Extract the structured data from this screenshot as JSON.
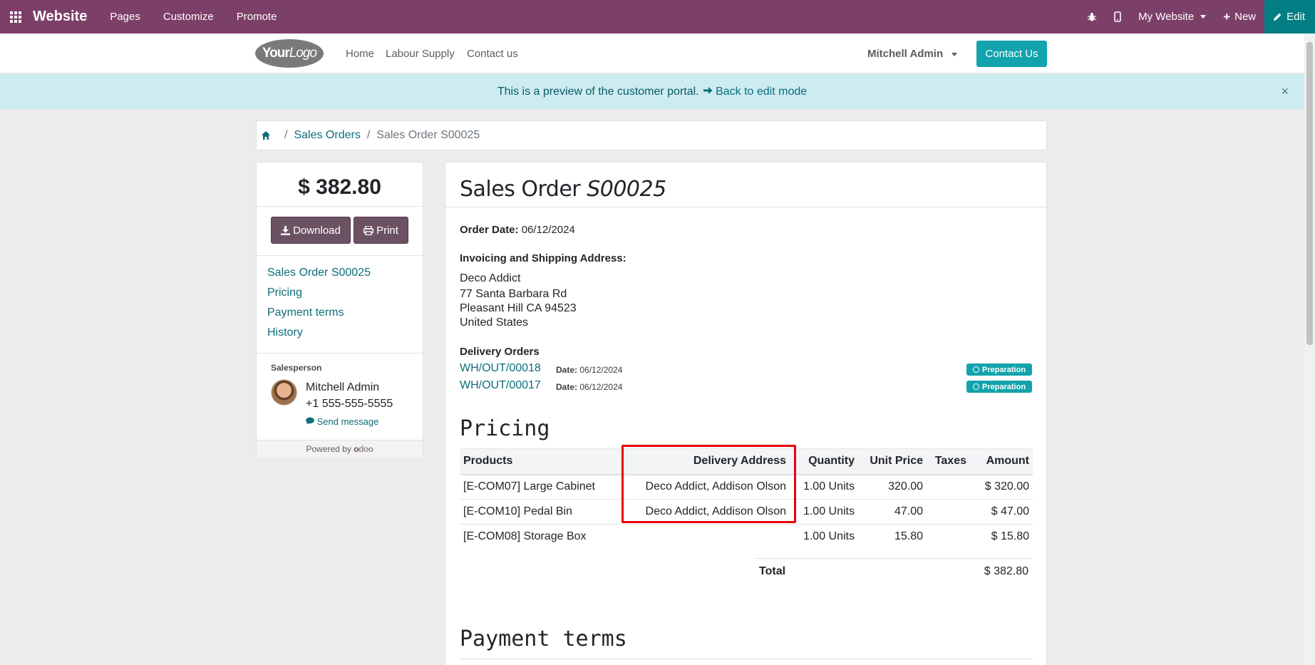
{
  "topbar": {
    "brand": "Website",
    "menus": [
      "Pages",
      "Customize",
      "Promote"
    ],
    "site_selector": "My Website",
    "new_label": "New",
    "edit_label": "Edit",
    "color": "#7c3f68"
  },
  "header": {
    "logo_text_bold": "Your",
    "logo_text": "Logo",
    "nav": [
      "Home",
      "Labour Supply",
      "Contact us"
    ],
    "user": "Mitchell Admin",
    "contact_button": "Contact Us"
  },
  "banner": {
    "text": "This is a preview of the customer portal.",
    "back_link": "Back to edit mode",
    "close": "×"
  },
  "breadcrumb": {
    "items": [
      "Sales Orders"
    ],
    "active": "Sales Order S00025"
  },
  "sidebar": {
    "total": "$ 382.80",
    "download_label": "Download",
    "print_label": "Print",
    "links": [
      "Sales Order S00025",
      "Pricing",
      "Payment terms",
      "History"
    ],
    "salesperson_title": "Salesperson",
    "salesperson_name": "Mitchell Admin",
    "salesperson_phone": "+1 555-555-5555",
    "send_message": "Send message",
    "powered_by": "Powered by",
    "odoo_o": "o",
    "odoo_rest": "doo"
  },
  "order": {
    "title_prefix": "Sales Order",
    "title_ref": "S00025",
    "order_date_label": "Order Date:",
    "order_date": "06/12/2024",
    "address_label": "Invoicing and Shipping Address:",
    "address_lines": [
      "Deco Addict",
      "77 Santa Barbara Rd",
      "Pleasant Hill CA 94523",
      "United States"
    ],
    "delivery_label": "Delivery Orders",
    "deliveries": [
      {
        "ref": "WH/OUT/00018",
        "date_label": "Date:",
        "date": "06/12/2024",
        "status": "Preparation"
      },
      {
        "ref": "WH/OUT/00017",
        "date_label": "Date:",
        "date": "06/12/2024",
        "status": "Preparation"
      }
    ]
  },
  "pricing": {
    "title": "Pricing",
    "columns": [
      "Products",
      "Delivery Address",
      "Quantity",
      "Unit Price",
      "Taxes",
      "Amount"
    ],
    "rows": [
      [
        "[E-COM07] Large Cabinet",
        "Deco Addict, Addison Olson",
        "1.00 Units",
        "320.00",
        "",
        "$ 320.00"
      ],
      [
        "[E-COM10] Pedal Bin",
        "Deco Addict, Addison Olson",
        "1.00 Units",
        "47.00",
        "",
        "$ 47.00"
      ],
      [
        "[E-COM08] Storage Box",
        "",
        "1.00 Units",
        "15.80",
        "",
        "$ 15.80"
      ]
    ],
    "total_label": "Total",
    "total_value": "$ 382.80"
  },
  "payment_terms": {
    "title": "Payment terms"
  },
  "colors": {
    "accent": "#12a3ad",
    "link": "#0b6e7a",
    "highlight": "#e6000e"
  }
}
